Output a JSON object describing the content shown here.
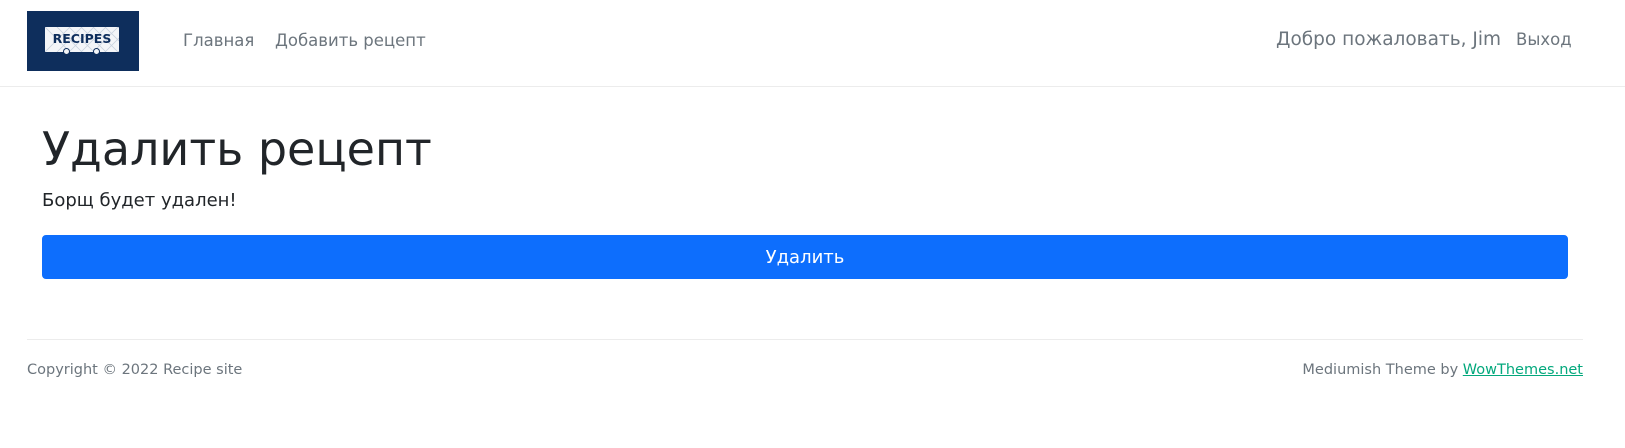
{
  "navbar": {
    "logo_text": "RECIPES",
    "links": {
      "home": "Главная",
      "add_recipe": "Добавить рецепт"
    },
    "welcome": "Добро пожаловать, Jim",
    "logout": "Выход"
  },
  "main": {
    "title": "Удалить рецепт",
    "message": "Борщ будет удален!",
    "delete_button": "Удалить"
  },
  "footer": {
    "copyright": "Copyright © 2022 Recipe site",
    "theme_prefix": "Mediumish Theme by ",
    "theme_link": "WowThemes.net"
  },
  "colors": {
    "logo_bg": "#0e2e5c",
    "primary": "#0d6efd",
    "link_green": "#03a87c",
    "muted": "#6c757d"
  }
}
